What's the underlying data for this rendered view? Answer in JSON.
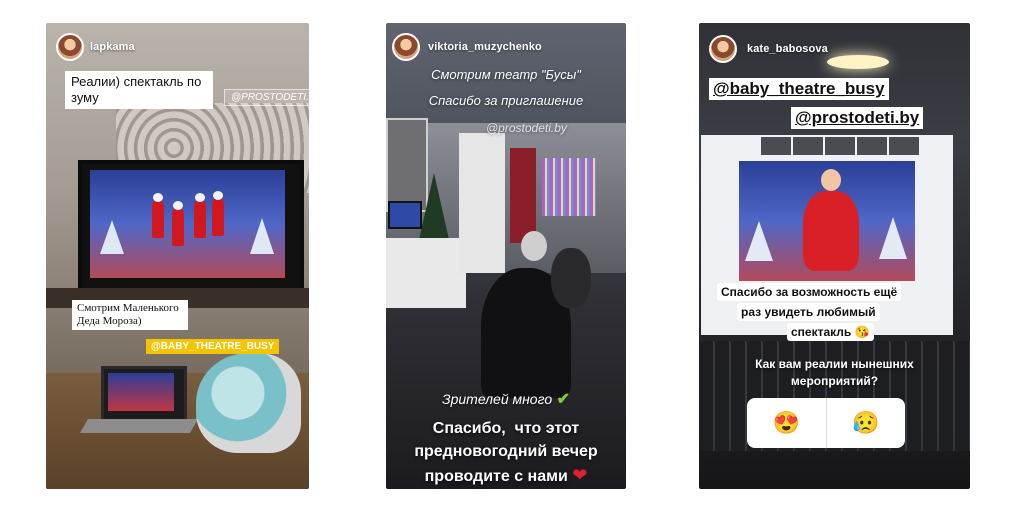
{
  "stories": [
    {
      "username": "lapkama",
      "caption_top": "Реалии) спектакль по зуму",
      "tag_site": "@PROSTODETI.BY",
      "caption_bottom": "Смотрим Маленького Деда Мороза)",
      "tag_theatre": "@BABY_THEATRE_BUSY"
    },
    {
      "username": "viktoria_muzychenko",
      "line1": "Смотрим театр \"Бусы\"",
      "line2": "Спасибо за приглашение",
      "tag_site": "@prostodeti.by",
      "viewers": "Зрителей много",
      "viewers_check": "✔",
      "thanks_line1": "Спасибо,  что этот",
      "thanks_line2": "предновогодний вечер",
      "thanks_line3": "проводите с нами",
      "heart": "❤"
    },
    {
      "username": "kate_babosova",
      "mention1": "@baby_theatre_busy",
      "mention2": "@prostodeti.by",
      "thanks_line1": "Спасибо за возможность ещё",
      "thanks_line2": "раз увидеть любимый",
      "thanks_line3": "спектакль 😘",
      "question_line1": "Как вам реалии нынешних",
      "question_line2": "мероприятий?",
      "poll_option_1": "😍",
      "poll_option_2": "😥"
    }
  ]
}
